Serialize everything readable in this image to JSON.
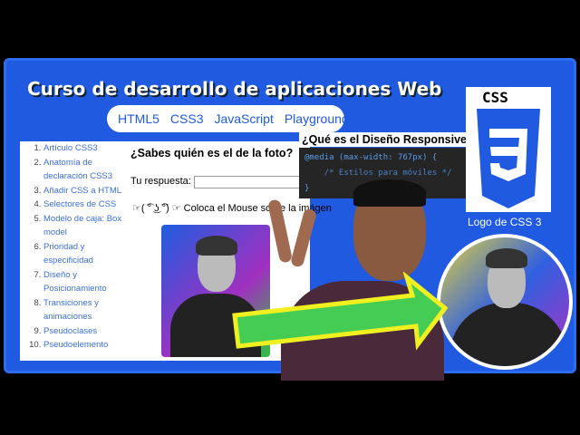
{
  "header": {
    "title": "Curso de desarrollo de aplicaciones Web",
    "nav": [
      "HTML5",
      "CSS3",
      "JavaScript",
      "Playground"
    ]
  },
  "sidebar": {
    "items": [
      "Artículo CSS3",
      "Anatomía de declaración CSS3",
      "Añadir CSS a HTML",
      "Selectores de CSS",
      "Modelo de caja: Box model",
      "Prioridad y especificidad",
      "Diseño y Posicionamiento",
      "Transiciones y animaciones",
      "Pseudoclases",
      "Pseudoelemento"
    ]
  },
  "main": {
    "question": "¿Sabes quién es el de la foto?",
    "answer_label": "Tu respuesta:",
    "answer_value": "",
    "hint": "☞( ͡° ͜ʖ ͡°) ☞ Coloca el Mouse sobre la imágen"
  },
  "overlay": {
    "responsive_title": "¿Qué es el Diseño Responsive?",
    "code": [
      "@media (max-width: 767px) {",
      "    /* Estilos para móviles */",
      "}"
    ]
  },
  "logo": {
    "text": "CSS",
    "caption": "Logo de CSS 3"
  },
  "colors": {
    "brand": "#1f5ae0",
    "arrow": "#44cc55",
    "arrow_border": "#f0f020"
  }
}
